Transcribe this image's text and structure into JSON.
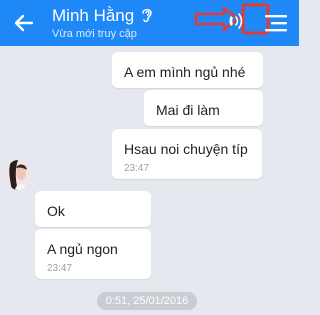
{
  "header": {
    "contact_name": "Minh Hằng",
    "status": "Vừa mới truy cập",
    "background_color": "#1e88f7",
    "icons": [
      "back-arrow-icon",
      "ear-icon",
      "call-icon",
      "menu-icon"
    ],
    "annotation_color": "#e53935"
  },
  "messages": [
    {
      "side": "outgoing",
      "text": "A em mình ngủ nhé"
    },
    {
      "side": "outgoing",
      "text": "Mai đi làm"
    },
    {
      "side": "outgoing",
      "text": "Hsau noi chuyện típ",
      "time": "23:47"
    },
    {
      "side": "incoming",
      "text": "Ok"
    },
    {
      "side": "incoming",
      "text": "A ngủ ngon",
      "time": "23:47"
    }
  ],
  "date_separator": "0:51, 25/01/2016"
}
